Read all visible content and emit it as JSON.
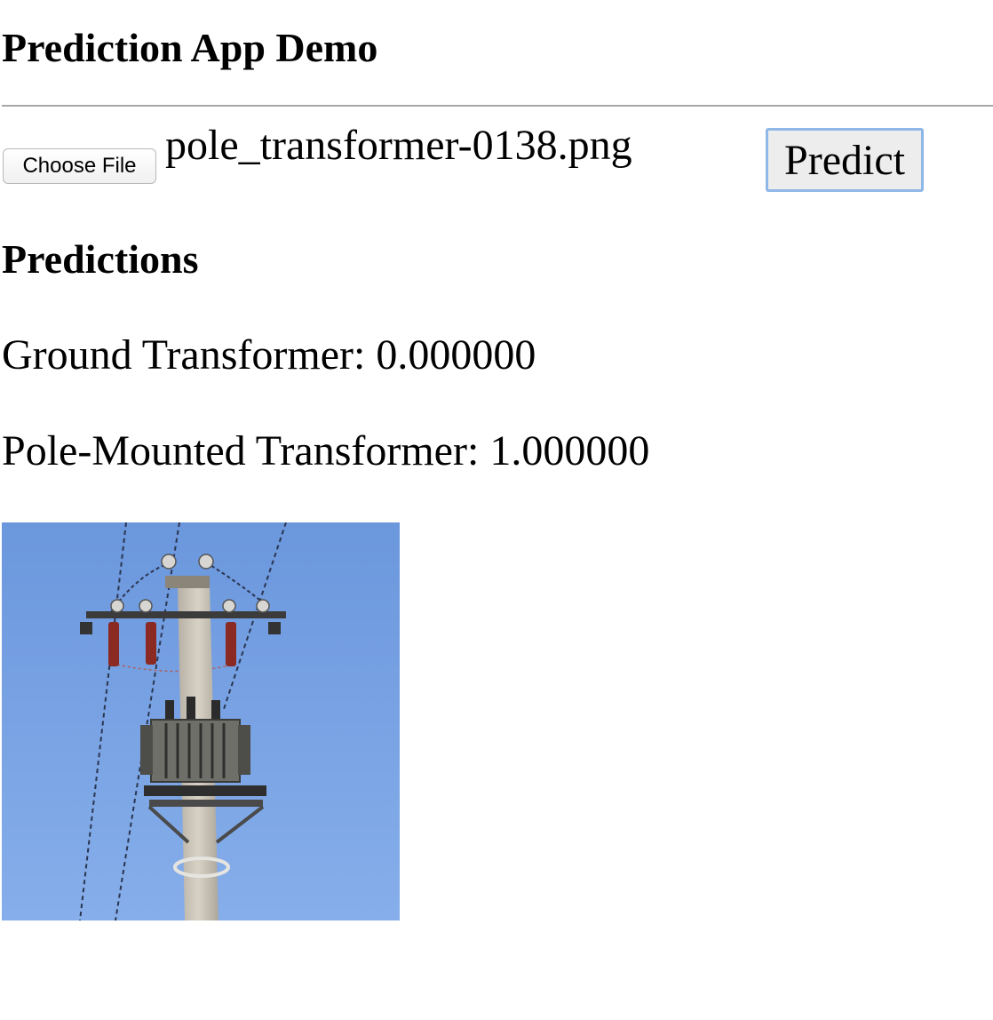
{
  "header": {
    "title": "Prediction App Demo"
  },
  "upload_form": {
    "choose_file_label": "Choose File",
    "selected_file_name": "pole_transformer-0138.png",
    "predict_label": "Predict"
  },
  "predictions": {
    "heading": "Predictions",
    "results": [
      {
        "label": "Ground Transformer",
        "separator": ": ",
        "score": "0.000000"
      },
      {
        "label": "Pole-Mounted Transformer",
        "separator": ": ",
        "score": "1.000000"
      }
    ]
  },
  "preview": {
    "sky_color_top": "#6b97dd",
    "sky_color_bottom": "#86aeea",
    "pole_color": "#c9c2b6",
    "transformer_color": "#6f6f6a",
    "insulator_color": "#8a2a22"
  }
}
